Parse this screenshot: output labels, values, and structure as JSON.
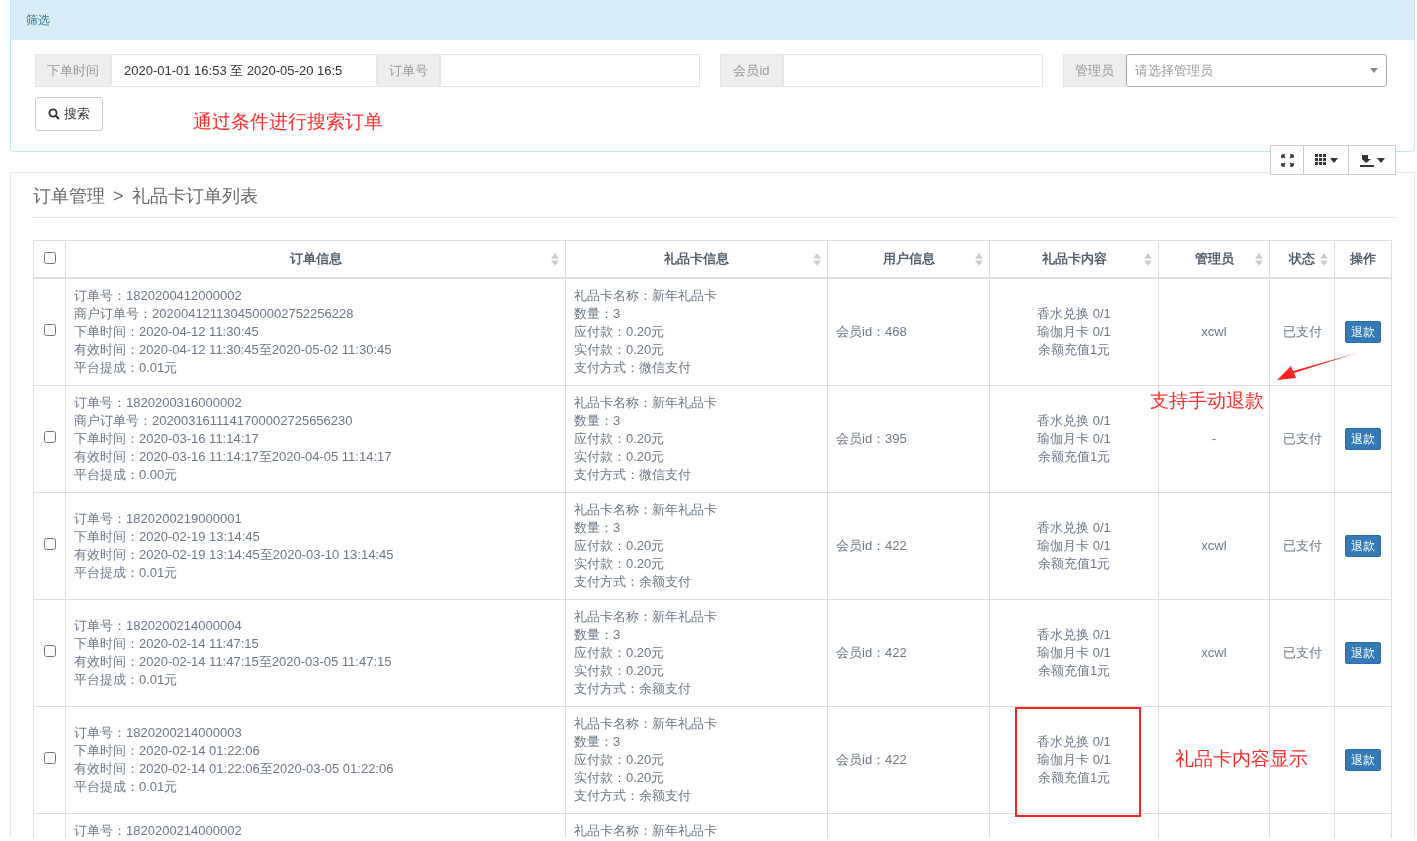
{
  "filter_panel": {
    "title": "筛选",
    "fields": [
      {
        "label": "下单时间",
        "value": "2020-01-01 16:53 至 2020-05-20 16:5",
        "kind": "text"
      },
      {
        "label": "订单号",
        "kind": "text"
      },
      {
        "label": "会员id",
        "kind": "text"
      },
      {
        "label": "管理员",
        "placeholder": "请选择管理员",
        "kind": "select"
      }
    ],
    "search_button": "搜索"
  },
  "breadcrumb": {
    "parent": "订单管理",
    "separator": ">",
    "current": "礼品卡订单列表"
  },
  "table": {
    "select_all": {
      "checked": false
    },
    "columns": [
      {
        "label": "订单信息",
        "sortable": true
      },
      {
        "label": "礼品卡信息",
        "sortable": true
      },
      {
        "label": "用户信息",
        "sortable": true
      },
      {
        "label": "礼品卡内容",
        "sortable": true
      },
      {
        "label": "管理员",
        "sortable": true
      },
      {
        "label": "状态",
        "sortable": true
      },
      {
        "label": "操作",
        "sortable": false
      }
    ],
    "rows": [
      {
        "checked": false,
        "order_info": [
          "订单号：1820200412000002",
          "商户订单号：2020041211304500002752256228",
          "下单时间：2020-04-12 11:30:45",
          "有效时间：2020-04-12 11:30:45至2020-05-02 11:30:45",
          "平台提成：0.01元"
        ],
        "card_info": [
          "礼品卡名称：新年礼品卡",
          "数量：3",
          "应付款：0.20元",
          "实付款：0.20元",
          "支付方式：微信支付"
        ],
        "user_info": "会员id：468",
        "card_content": [
          "香水兑换 0/1",
          "瑜伽月卡 0/1",
          "余额充值1元"
        ],
        "admin": "xcwl",
        "status": "已支付",
        "action": "退款"
      },
      {
        "checked": false,
        "order_info": [
          "订单号：1820200316000002",
          "商户订单号：2020031611141700002725656230",
          "下单时间：2020-03-16 11:14:17",
          "有效时间：2020-03-16 11:14:17至2020-04-05 11:14:17",
          "平台提成：0.00元"
        ],
        "card_info": [
          "礼品卡名称：新年礼品卡",
          "数量：3",
          "应付款：0.20元",
          "实付款：0.20元",
          "支付方式：微信支付"
        ],
        "user_info": "会员id：395",
        "card_content": [
          "香水兑换 0/1",
          "瑜伽月卡 0/1",
          "余额充值1元"
        ],
        "admin": "-",
        "status": "已支付",
        "action": "退款"
      },
      {
        "checked": false,
        "order_info": [
          "订单号：1820200219000001",
          "下单时间：2020-02-19 13:14:45",
          "有效时间：2020-02-19 13:14:45至2020-03-10 13:14:45",
          "平台提成：0.01元"
        ],
        "card_info": [
          "礼品卡名称：新年礼品卡",
          "数量：3",
          "应付款：0.20元",
          "实付款：0.20元",
          "支付方式：余额支付"
        ],
        "user_info": "会员id：422",
        "card_content": [
          "香水兑换 0/1",
          "瑜伽月卡 0/1",
          "余额充值1元"
        ],
        "admin": "xcwl",
        "status": "已支付",
        "action": "退款"
      },
      {
        "checked": false,
        "order_info": [
          "订单号：1820200214000004",
          "下单时间：2020-02-14 11:47:15",
          "有效时间：2020-02-14 11:47:15至2020-03-05 11:47:15",
          "平台提成：0.01元"
        ],
        "card_info": [
          "礼品卡名称：新年礼品卡",
          "数量：3",
          "应付款：0.20元",
          "实付款：0.20元",
          "支付方式：余额支付"
        ],
        "user_info": "会员id：422",
        "card_content": [
          "香水兑换 0/1",
          "瑜伽月卡 0/1",
          "余额充值1元"
        ],
        "admin": "xcwl",
        "status": "已支付",
        "action": "退款"
      },
      {
        "checked": false,
        "order_info": [
          "订单号：1820200214000003",
          "下单时间：2020-02-14 01:22:06",
          "有效时间：2020-02-14 01:22:06至2020-03-05 01:22:06",
          "平台提成：0.01元"
        ],
        "card_info": [
          "礼品卡名称：新年礼品卡",
          "数量：3",
          "应付款：0.20元",
          "实付款：0.20元",
          "支付方式：余额支付"
        ],
        "user_info": "会员id：422",
        "card_content": [
          "香水兑换 0/1",
          "瑜伽月卡 0/1",
          "余额充值1元"
        ],
        "action": "退款"
      },
      {
        "order_info": [
          "订单号：1820200214000002"
        ],
        "card_info": [
          "礼品卡名称：新年礼品卡"
        ]
      }
    ]
  },
  "annotations": [
    {
      "kind": "note",
      "text": "通过条件进行搜索订单"
    },
    {
      "kind": "note",
      "text": "支持手动退款"
    },
    {
      "kind": "arrow"
    },
    {
      "kind": "box"
    },
    {
      "kind": "note",
      "text": "礼品卡内容显示"
    }
  ]
}
